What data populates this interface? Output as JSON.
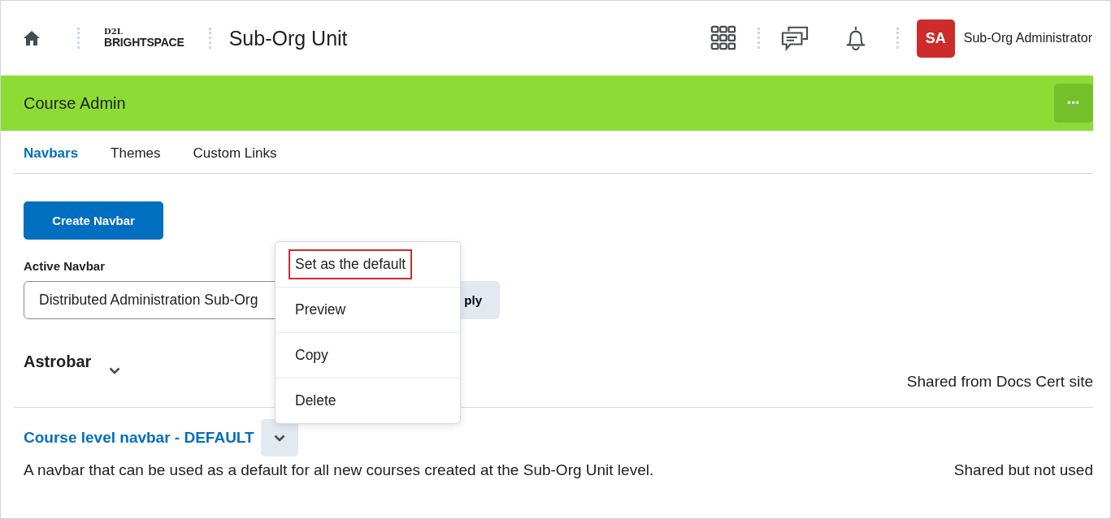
{
  "header": {
    "logo_top": "D2L",
    "logo_bottom": "BRIGHTSPACE",
    "title": "Sub-Org Unit",
    "avatar": "SA",
    "user": "Sub-Org Administrator"
  },
  "banner": {
    "title": "Course Admin",
    "menu": "•••"
  },
  "tabs": [
    {
      "label": "Navbars",
      "selected": true
    },
    {
      "label": "Themes",
      "selected": false
    },
    {
      "label": "Custom Links",
      "selected": false
    }
  ],
  "create_button": "Create Navbar",
  "active_navbar": {
    "label": "Active Navbar",
    "value": "Distributed Administration Sub-Org",
    "apply": "ply"
  },
  "menu": [
    {
      "label": "Set as the default",
      "selected": true
    },
    {
      "label": "Preview",
      "selected": false
    },
    {
      "label": "Copy",
      "selected": false
    },
    {
      "label": "Delete",
      "selected": false
    }
  ],
  "sections": [
    {
      "kind": "plain",
      "title": "Astrobar",
      "shared": "Shared from Docs Cert site"
    },
    {
      "kind": "link",
      "title": "Course level navbar - DEFAULT",
      "description": "A navbar that can be used as a default for all new courses created at the Sub-Org Unit level.",
      "shared": "Shared but not used"
    }
  ]
}
